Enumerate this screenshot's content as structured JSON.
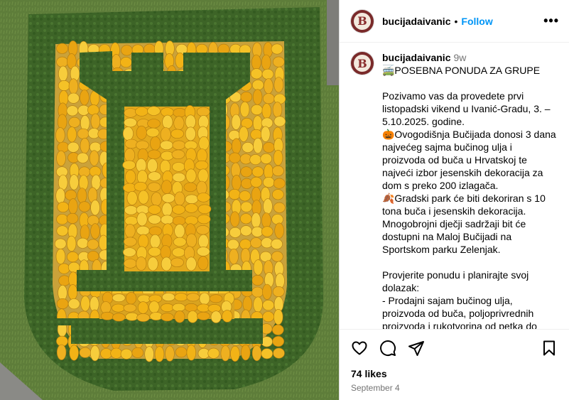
{
  "post": {
    "username": "bucijadaivanic",
    "follow_label": "Follow",
    "more_label": "•••",
    "avatar_letter": "B"
  },
  "caption": {
    "username": "bucijadaivanic",
    "time": "9w",
    "text": "🚎POSEBNA PONUDA ZA GRUPE\n\nPozivamo vas da provedete prvi listopadski vikend u Ivanić-Gradu, 3. – 5.10.2025. godine.\n🎃Ovogodišnja Bučijada donosi 3 dana najvećeg sajma bučinog ulja i proizvoda od buča u Hrvatskoj te najveći izbor jesenskih dekoracija za dom s preko 200 izlagača.\n🍂Gradski park će biti dekoriran s 10 tona buča i jesenskih dekoracija. Mnogobrojni dječji sadržaji bit će dostupni na Maloj Bučijadi na Sportskom parku Zelenjak.\n\nProvjerite ponudu i planirajte svoj dolazak:\n- Prodajni sajam bučinog ulja, proizvoda od buča, poljoprivrednih proizvoda i rukotvorina od petka do"
  },
  "footer": {
    "likes": "74 likes",
    "date": "September 4"
  },
  "icons": [
    "heart-icon",
    "comment-icon",
    "share-icon",
    "bookmark-icon",
    "more-icon"
  ],
  "colors": {
    "link": "#0095f6",
    "pumpkin": "#f2b316",
    "hedge": "#3f6a2a",
    "grass": "#5f7f3a"
  }
}
